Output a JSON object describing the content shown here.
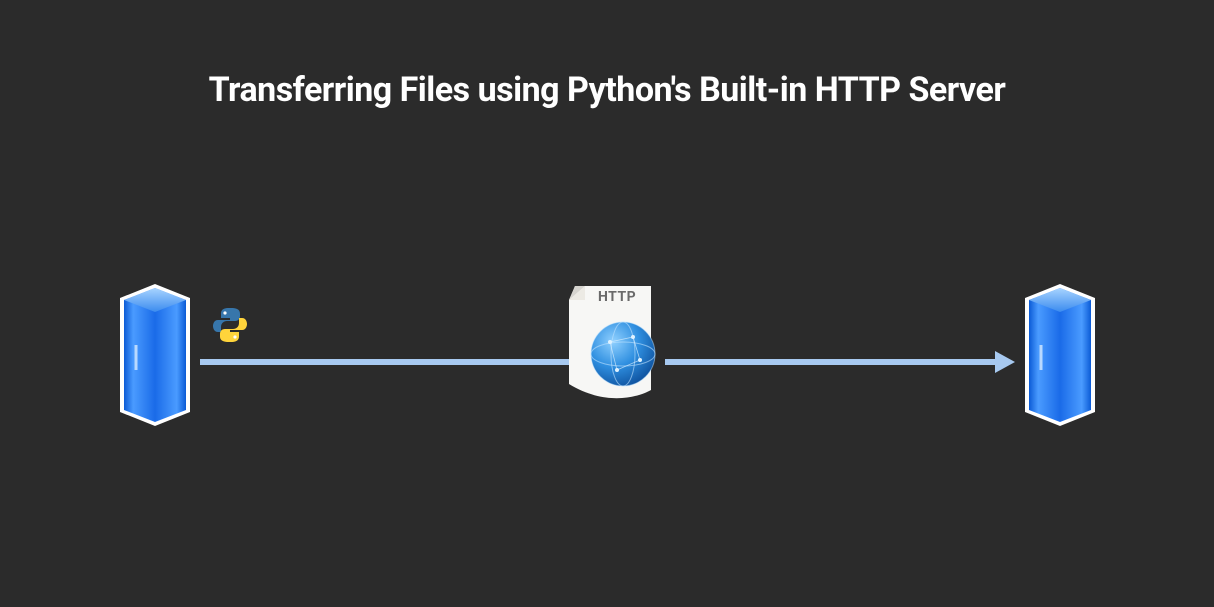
{
  "title": "Transferring Files using Python's Built-in HTTP Server",
  "http_label": "HTTP",
  "nodes": {
    "left": "server",
    "left_badge": "python",
    "center": "http-document",
    "right": "server"
  }
}
